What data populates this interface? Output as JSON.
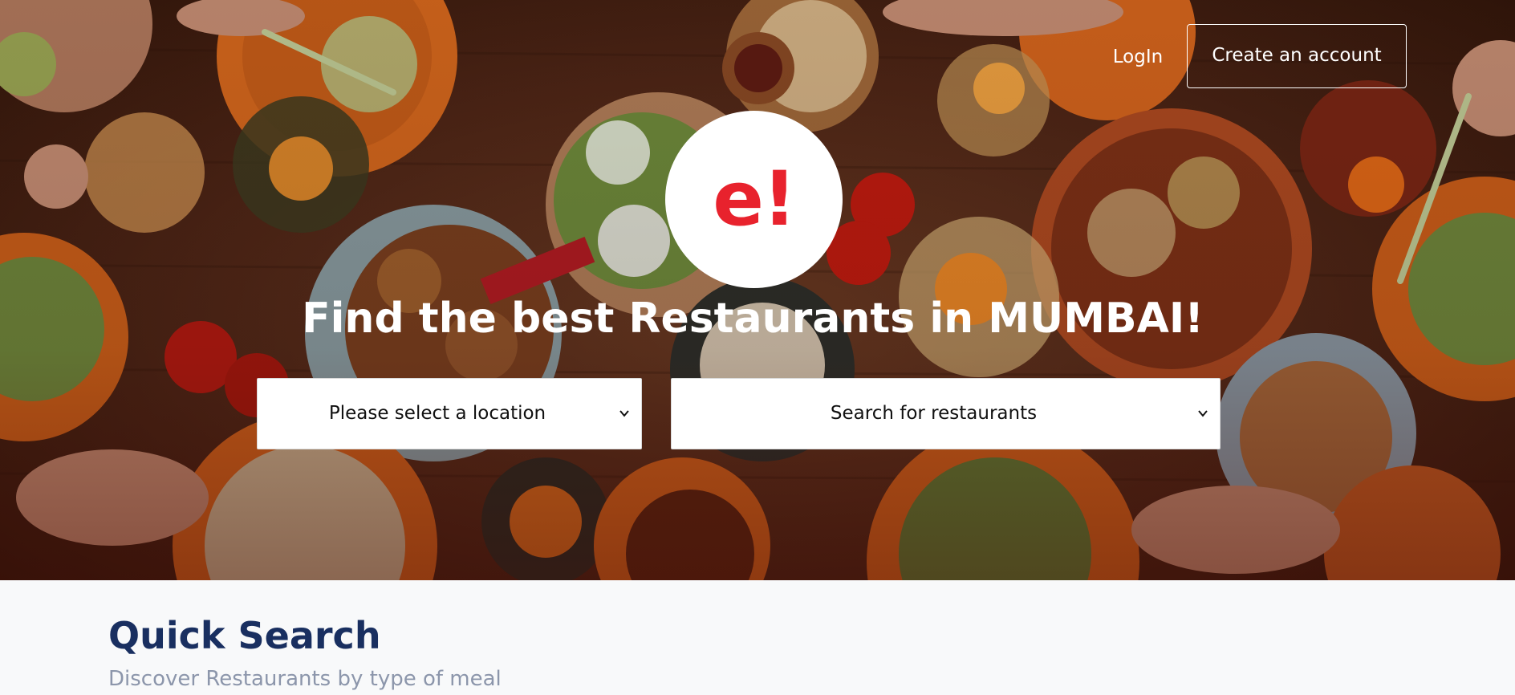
{
  "header": {
    "login_label": "LogIn",
    "create_account_label": "Create an account"
  },
  "hero": {
    "logo_text": "e!",
    "headline": "Find the best Restaurants in MUMBAI!",
    "location_select": {
      "selected": "Please select a location",
      "icon": "chevron-down-icon"
    },
    "restaurant_select": {
      "selected": "Search for restaurants",
      "icon": "chevron-down-icon"
    }
  },
  "quick_search": {
    "title": "Quick Search",
    "subtitle": "Discover Restaurants by type of meal"
  },
  "colors": {
    "brand_red": "#e8222d",
    "heading_navy": "#192f60",
    "subtitle_gray": "#8c96ab",
    "page_background": "#f8f9fa"
  }
}
